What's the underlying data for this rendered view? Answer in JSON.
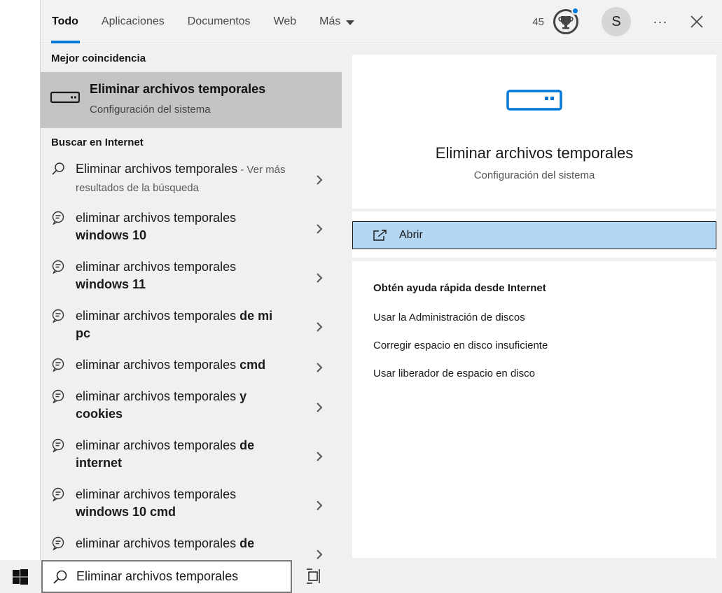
{
  "nav": {
    "tabs": [
      {
        "label": "Todo"
      },
      {
        "label": "Aplicaciones"
      },
      {
        "label": "Documentos"
      },
      {
        "label": "Web"
      },
      {
        "label": "Más"
      }
    ],
    "points": "45",
    "avatar_letter": "S",
    "more_label": "···"
  },
  "results": {
    "best_match_heading": "Mejor coincidencia",
    "best_match": {
      "title": "Eliminar archivos temporales",
      "subtitle": "Configuración del sistema",
      "icon": "storage-drive-icon"
    },
    "web_heading": "Buscar en Internet",
    "web_first": {
      "title": "Eliminar archivos temporales",
      "suffix": " - Ver más resultados de la búsqueda"
    },
    "suggestions": [
      {
        "base": "eliminar archivos temporales ",
        "bold": "windows 10"
      },
      {
        "base": "eliminar archivos temporales ",
        "bold": "windows 11"
      },
      {
        "base": "eliminar archivos temporales ",
        "bold": "de mi pc"
      },
      {
        "base": "eliminar archivos temporales ",
        "bold": "cmd"
      },
      {
        "base": "eliminar archivos temporales ",
        "bold": "y cookies"
      },
      {
        "base": "eliminar archivos temporales ",
        "bold": "de internet"
      },
      {
        "base": "eliminar archivos temporales ",
        "bold": "windows 10 cmd"
      },
      {
        "base": "eliminar archivos temporales ",
        "bold": "de"
      }
    ]
  },
  "detail": {
    "title": "Eliminar archivos temporales",
    "subtitle": "Configuración del sistema",
    "open_label": "Abrir",
    "help_heading": "Obtén ayuda rápida desde Internet",
    "help_links": [
      "Usar la Administración de discos",
      "Corregir espacio en disco insuficiente",
      "Usar liberador de espacio en disco"
    ]
  },
  "taskbar": {
    "search_value": "Eliminar archivos temporales"
  },
  "colors": {
    "accent": "#0078d7",
    "selected_row": "#c4c4c4",
    "open_button": "#b3d6f2",
    "panel_bg": "#f0f0f0"
  }
}
